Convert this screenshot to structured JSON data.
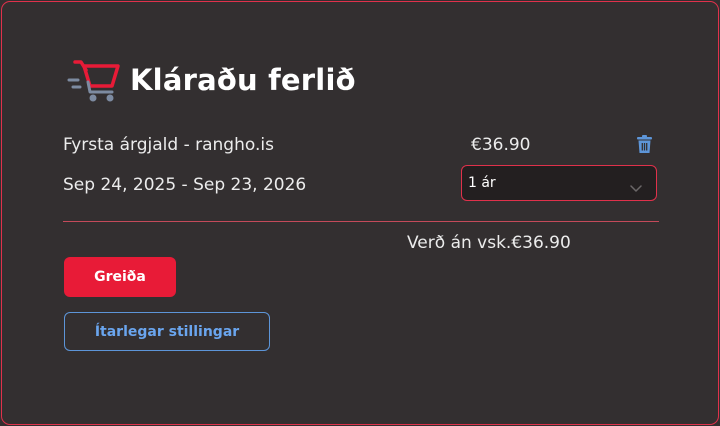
{
  "checkout": {
    "title": "Kláraðu ferlið",
    "icon": "shopping-cart-icon"
  },
  "item": {
    "name": "Fyrsta árgjald - rangho.is",
    "price": "€36.90",
    "dates": "Sep 24, 2025 - Sep 23, 2026",
    "period_selected": "1 ár",
    "delete_icon": "trash-icon"
  },
  "summary": {
    "subtotal": "Verð án vsk.€36.90"
  },
  "actions": {
    "pay_label": "Greiða",
    "advanced_label": "Ítarlegar stillingar"
  },
  "colors": {
    "accent": "#e81b37",
    "border": "#e0314b",
    "link": "#6aa5ee",
    "background": "#332f30"
  }
}
